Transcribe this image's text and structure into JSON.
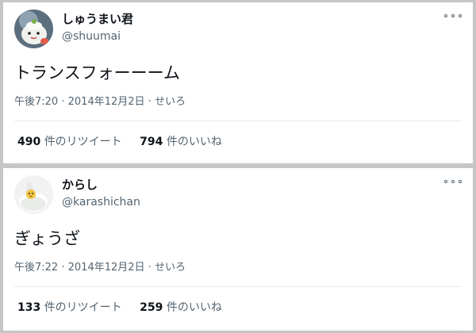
{
  "tweets": [
    {
      "name": "しゅうまい君",
      "handle": "@shuumai",
      "text": "トランスフォーーーム",
      "time": "午後7:20",
      "date": "2014年12月2日",
      "client": "せいろ",
      "retweets": "490",
      "retweet_label": "件のリツイート",
      "likes": "794",
      "like_label": "件のいいね",
      "avatar_icon": "shumai-character-avatar",
      "more_icon": "more-options-icon"
    },
    {
      "name": "からし",
      "handle": "@karashichan",
      "text": "ぎょうざ",
      "time": "午後7:22",
      "date": "2014年12月2日",
      "client": "せいろ",
      "retweets": "133",
      "retweet_label": "件のリツイート",
      "likes": "259",
      "like_label": "件のいいね",
      "avatar_icon": "karashi-character-avatar",
      "more_icon": "more-options-icon"
    }
  ],
  "meta_separator": "·",
  "colors": {
    "background": "#c6c6c6",
    "card": "#ffffff",
    "text": "#0f1419",
    "secondary": "#536471",
    "divider": "#e6ecf0"
  }
}
